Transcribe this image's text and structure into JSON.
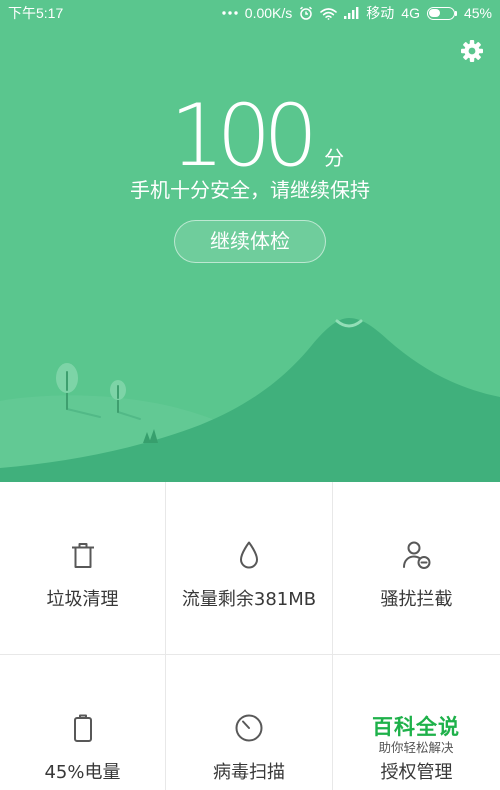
{
  "status_bar": {
    "time": "下午5:17",
    "more_icon": "more-dots-icon",
    "network_speed": "0.00K/s",
    "alarm_icon": "alarm-icon",
    "wifi_icon": "wifi-icon",
    "signal_icon": "signal-icon",
    "carrier": "移动",
    "network_type": "4G",
    "battery_icon": "battery-icon",
    "battery_fill_percent": 45,
    "battery_text": "45%"
  },
  "header": {
    "settings_icon": "gear-icon",
    "score": "100",
    "score_unit": "分",
    "message": "手机十分安全，请继续保持",
    "action_label": "继续体检"
  },
  "tools": [
    {
      "label": "垃圾清理",
      "icon": "trash-icon"
    },
    {
      "label": "流量剩余381MB",
      "icon": "drop-icon"
    },
    {
      "label": "骚扰拦截",
      "icon": "user-block-icon"
    },
    {
      "label": "45%电量",
      "icon": "battery-icon"
    },
    {
      "label": "病毒扫描",
      "icon": "timer-scan-icon"
    },
    {
      "label": "授权管理"
    }
  ],
  "watermark": {
    "title": "百科全说",
    "subtitle": "助你轻松解决"
  },
  "colors": {
    "header_green": "#5AC68E",
    "mountain_green": "#40B07C",
    "hill_green": "#62C994",
    "watermark_green": "#1EB14A",
    "icon_gray": "#585858",
    "label_gray": "#383838"
  }
}
